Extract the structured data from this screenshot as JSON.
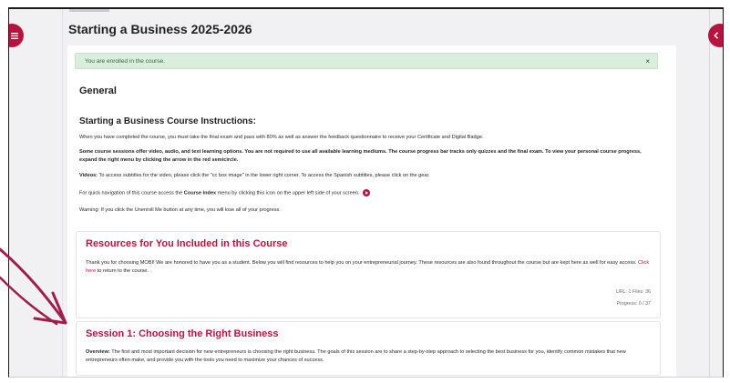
{
  "page": {
    "title": "Starting a Business 2025-2026"
  },
  "alert": {
    "text": "You are enrolled in the course.",
    "close": "×"
  },
  "section": {
    "title": "General"
  },
  "instructions": {
    "title": "Starting a Business Course Instructions:",
    "p1": "When you have completed the course, you must take the final exam and pass with 80% as well as answer the feedback questionnaire to receive your Certificate and Digital Badge.",
    "p2": "Some course sessions offer video, audio, and text learning options. You are not required to use all available learning mediums. The course progress bar tracks only quizzes and the final exam. To view your personal course progress, expand the right menu by clicking the arrow in the red semicircle.",
    "p3_label": "Videos:",
    "p3_text": " To access subtitles for the video, please click the \"cc box image\" in the lower right corner. To access the Spanish subtitles, please click on the gear.",
    "p4_pre": "For quick navigation of this course access the ",
    "p4_bold": "Course Index",
    "p4_post": " menu by clicking this icon on the upper left side of your screen.",
    "p5": "Warning: If you click the Unenroll Me button at any time, you will lose all of your progress."
  },
  "resources": {
    "title": "Resources for You Included in this Course",
    "text_pre": "Thank you for choosing MOBI! We are honored to have you as a student.  Below you will find resources to help you on your entrepreneurial journey.  These resources are also found throughout the course but are kept here as well for easy access. ",
    "link": "Click here",
    "text_post": " to return to the course.",
    "meta1": "URL: 1   Files: 36",
    "meta2": "Progress: 0 / 37"
  },
  "session1": {
    "title": "Session 1: Choosing the Right Business",
    "label": "Overview:",
    "text": " The first and most important decision for new entrepreneurs is choosing the right business. The goals of this session are to share a step-by-step approach to selecting the best business for you, identify common mistakes that new entrepreneurs often make, and provide you with the tools you need to maximize your chances of success."
  },
  "colors": {
    "accent": "#b8123e",
    "alert_bg": "#dbeedd",
    "annotation": "#9e1e4c"
  },
  "icons": {
    "left": "course-index-icon",
    "right": "chevron-left-icon"
  }
}
